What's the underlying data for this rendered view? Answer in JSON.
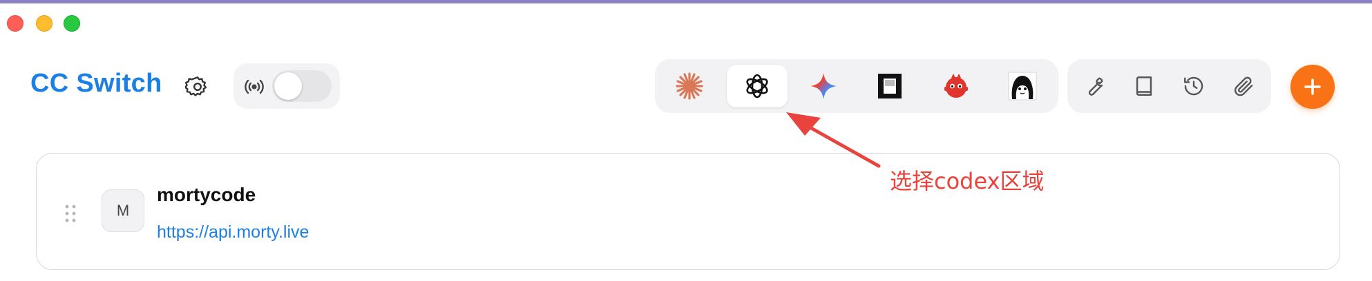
{
  "window": {
    "controls": [
      "close",
      "minimize",
      "zoom"
    ]
  },
  "header": {
    "app_title": "CC Switch",
    "settings_icon": "gear-icon",
    "proxy_icon": "broadcast-icon",
    "proxy_toggle_on": false
  },
  "providers": {
    "active_index": 1,
    "items": [
      {
        "icon": "claude-sparkle-icon",
        "color": "#d97757"
      },
      {
        "icon": "openai-codex-icon",
        "color": "#111111"
      },
      {
        "icon": "gemini-star-icon",
        "color": "#4e86f7"
      },
      {
        "icon": "terminal-app-icon",
        "color": "#111111"
      },
      {
        "icon": "red-mascot-icon",
        "color": "#e0342c"
      },
      {
        "icon": "anime-avatar-icon",
        "color": "#111111"
      }
    ]
  },
  "tools": [
    {
      "icon": "wrench-icon"
    },
    {
      "icon": "book-icon"
    },
    {
      "icon": "history-icon"
    },
    {
      "icon": "paperclip-icon"
    }
  ],
  "add_button": {
    "icon": "plus-icon",
    "color": "#f97316"
  },
  "provider_card": {
    "avatar_letter": "M",
    "name": "mortycode",
    "url": "https://api.morty.live"
  },
  "annotation": {
    "text": "选择codex区域",
    "color": "#e8433c"
  }
}
